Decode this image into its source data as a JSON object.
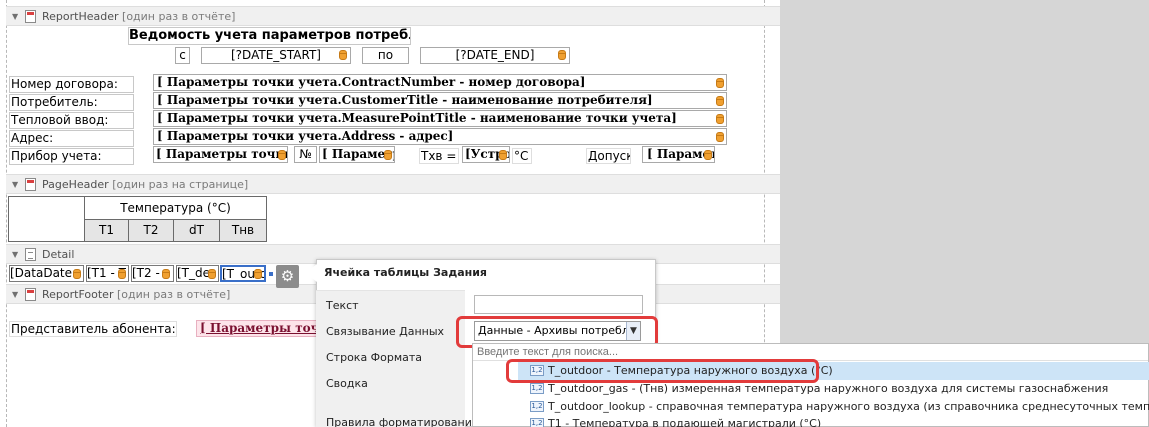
{
  "bands": {
    "report_header": "ReportHeader",
    "report_header_note": "[один раз в отчёте]",
    "page_header": "PageHeader",
    "page_header_note": "[один раз на странице]",
    "detail": "Detail",
    "report_footer": "ReportFooter",
    "report_footer_note": "[один раз в отчёте]"
  },
  "report_header": {
    "title": "Ведомость учета параметров потребления тепла",
    "from_label": "с",
    "date_start": "[?DATE_START]",
    "to_label": "по",
    "date_end": "[?DATE_END]",
    "rows": [
      {
        "label": "Номер договора:",
        "value": "[ Параметры точки учета.ContractNumber - номер договора]"
      },
      {
        "label": "Потребитель:",
        "value": "[ Параметры точки учета.CustomerTitle - наименование потребителя]"
      },
      {
        "label": "Тепловой ввод:",
        "value": "[ Параметры точки учета.MeasurePointTitle - наименование точки учета]"
      },
      {
        "label": "Адрес:",
        "value": "[ Параметры точки учета.Address - адрес]"
      }
    ],
    "device_label": "Прибор учета:",
    "device_value": "[ Параметры точки уч",
    "number_label": "№",
    "number_value": "[ Параметр",
    "tcw_label": "Тхв =",
    "tcw_value": "[Устро",
    "tcw_unit": "°C",
    "admission_label": "Допуск:",
    "admission_value": "[ Парамет"
  },
  "page_header": {
    "group_title": "Температура (°C)",
    "columns": [
      "T1",
      "T2",
      "dT",
      "Тнв"
    ]
  },
  "detail": {
    "cells": [
      "[DataDate - д",
      "[T1 - T",
      "[T2 -",
      "[T_de",
      "[T_outd"
    ]
  },
  "report_footer": {
    "label": "Представитель абонента:",
    "value": "[ Параметры точки у"
  },
  "popup": {
    "title": "Ячейка таблицы Задания",
    "text_label": "Текст",
    "text_value": "",
    "binding_label": "Связывание Данных",
    "binding_value": "Данные - Архивы потреблен",
    "format_label": "Строка Формата",
    "summary_label": "Сводка",
    "rules_label": "Правила форматирования",
    "search_placeholder": "Введите текст для поиска..."
  },
  "dropdown_items": [
    {
      "icon": "1,2",
      "text": "T_outdoor - Температура наружного воздуха (°C)"
    },
    {
      "icon": "1,2",
      "text": "T_outdoor_gas - (Тнв) измеренная температура наружного воздуха для системы газоснабжения"
    },
    {
      "icon": "1,2",
      "text": "T_outdoor_lookup - справочная температура наружного воздуха (из справочника среднесуточных температур)"
    },
    {
      "icon": "1,2",
      "text": "T1 - Температура в подающей магистрали (°C)"
    }
  ],
  "colors": {
    "highlight": "#e23b3b",
    "selected_item": "#cde4f7",
    "db_icon": "#f0a030"
  }
}
